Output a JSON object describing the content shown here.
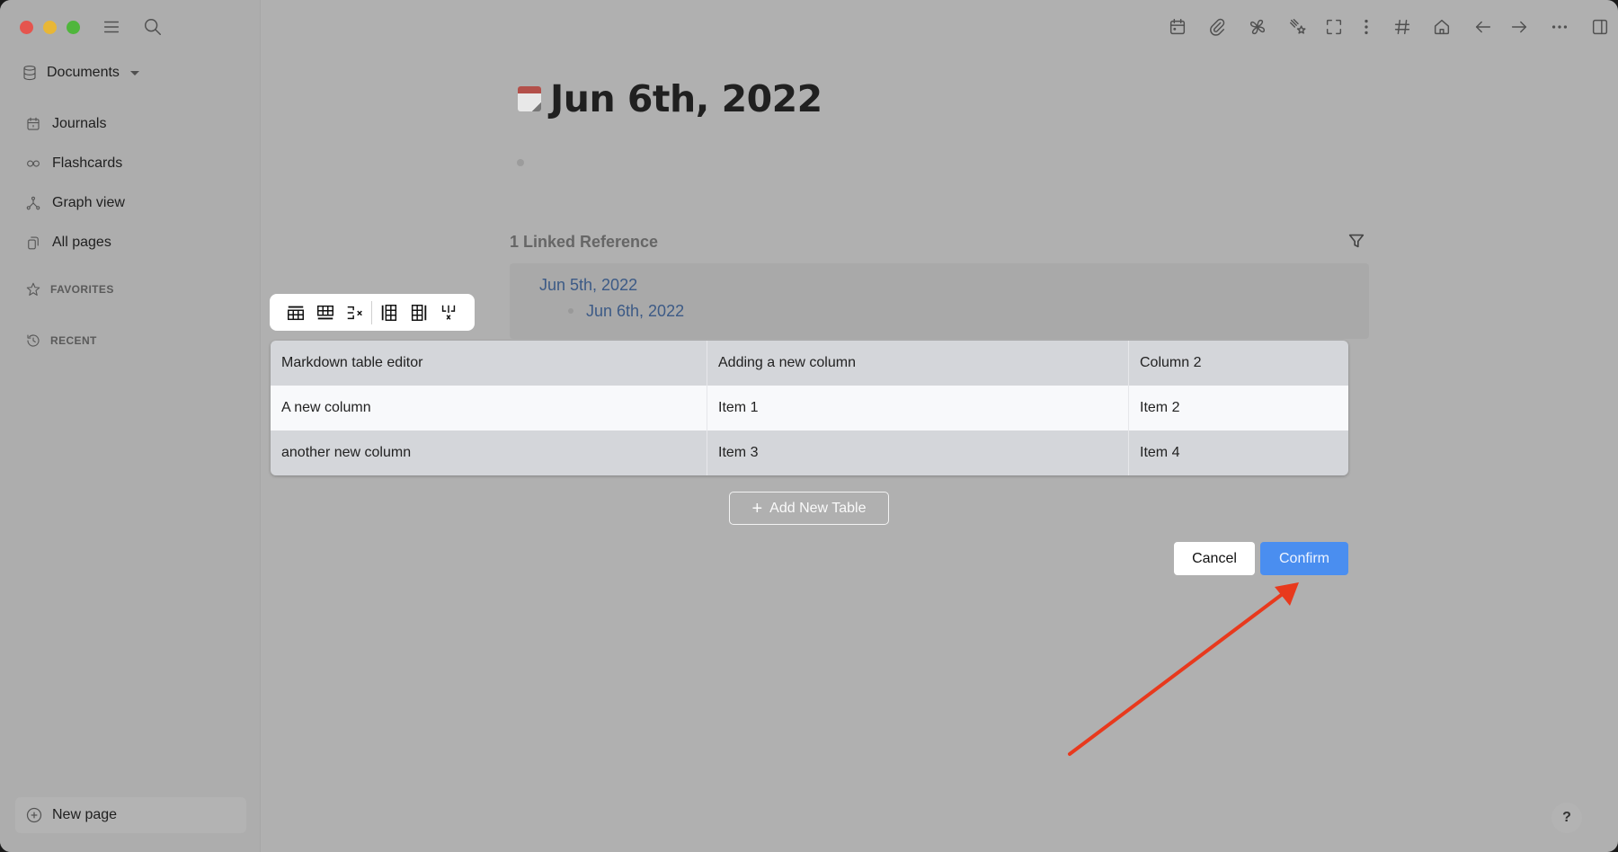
{
  "window": {
    "traffic_lights": [
      "close",
      "minimize",
      "zoom"
    ]
  },
  "sidebar": {
    "workspace_label": "Documents",
    "nav": [
      {
        "label": "Journals",
        "icon": "calendar-icon"
      },
      {
        "label": "Flashcards",
        "icon": "infinity-icon"
      },
      {
        "label": "Graph view",
        "icon": "graph-icon"
      },
      {
        "label": "All pages",
        "icon": "pages-icon"
      }
    ],
    "favorites_label": "FAVORITES",
    "recent_label": "RECENT",
    "new_page_label": "New page"
  },
  "toolbar": {
    "icons": [
      "calendar-icon",
      "paperclip-icon",
      "pinwheel-icon",
      "shooting-star-icon",
      "fullscreen-icon",
      "vertical-dots-icon",
      "hash-icon",
      "home-icon",
      "arrow-left-icon",
      "arrow-right-icon",
      "more-horizontal-icon",
      "right-sidebar-icon"
    ]
  },
  "page": {
    "title": "Jun 6th, 2022",
    "linked_references": {
      "heading": "1 Linked Reference",
      "parent": "Jun 5th, 2022",
      "child": "Jun 6th, 2022"
    }
  },
  "table_editor": {
    "toolbar_actions": [
      "insert-row-above",
      "insert-row-below",
      "delete-row",
      "insert-column-left",
      "insert-column-right",
      "delete-column"
    ],
    "headers": [
      "Markdown table editor",
      "Adding a new column",
      "Column 2"
    ],
    "rows": [
      [
        "A new column",
        "Item 1",
        "Item 2"
      ],
      [
        "another new column",
        "Item 3",
        "Item 4"
      ]
    ],
    "add_table_label": "Add New Table",
    "cancel_label": "Cancel",
    "confirm_label": "Confirm"
  },
  "annotation": {
    "arrow_color": "#e8391d",
    "points_to": "Confirm"
  },
  "help_label": "?"
}
